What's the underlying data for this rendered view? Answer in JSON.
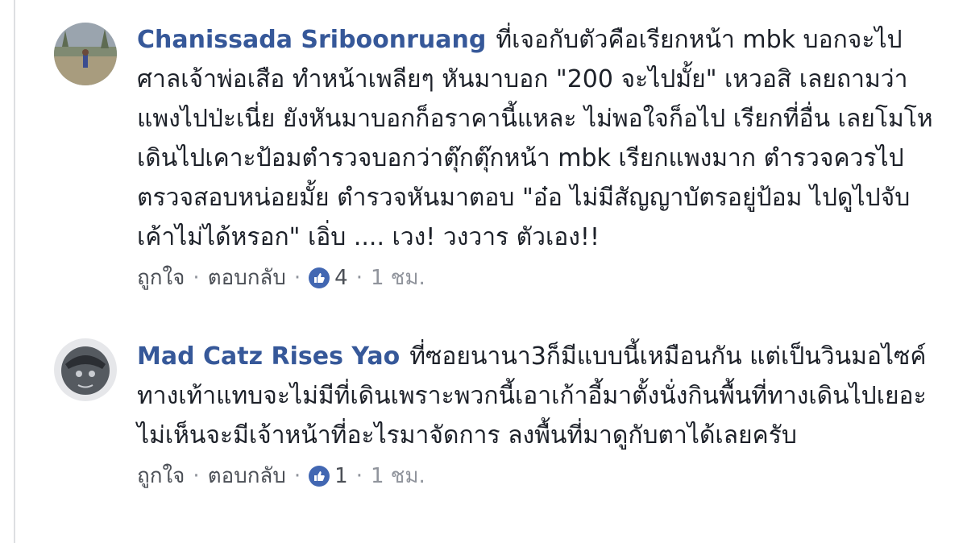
{
  "comments": [
    {
      "author": "Chanissada Sriboonruang",
      "text": "ที่เจอกับตัวคือเรียกหน้า mbk บอกจะไปศาลเจ้าพ่อเสือ ทำหน้าเพลียๆ หันมาบอก \"200 จะไปมั้ย\" เหวอสิ เลยถามว่าแพงไปป่ะเนี่ย ยังหันมาบอกก็อราคานี้แหละ ไม่พอใจก็อไป เรียกที่อื่น เลยโมโหเดินไปเคาะป้อมตำรวจบอกว่าตุ๊กตุ๊กหน้า mbk เรียกแพงมาก ตำรวจควรไปตรวจสอบหน่อยมั้ย ตำรวจหันมาตอบ \"อ๋อ ไม่มีสัญญาบัตรอยู่ป้อม ไปดูไปจับเค้าไม่ได้หรอก\" เอิ่บ .... เวง! วงวาร ตัวเอง!!",
      "like_label": "ถูกใจ",
      "reply_label": "ตอบกลับ",
      "reaction_count": "4",
      "time": "1 ชม."
    },
    {
      "author": "Mad Catz Rises Yao",
      "text": "ที่ซอยนานา3ก็มีแบบนี้เหมือนกัน แต่เป็นวินมอไซค์ ทางเท้าแทบจะไม่มีที่เดินเพราะพวกนี้เอาเก้าอี้มาตั้งนั่งกินพื้นที่ทางเดินไปเยอะ ไม่เห็นจะมีเจ้าหน้าที่อะไรมาจัดการ ลงพื้นที่มาดูกับตาได้เลยครับ",
      "like_label": "ถูกใจ",
      "reply_label": "ตอบกลับ",
      "reaction_count": "1",
      "time": "1 ชม."
    }
  ],
  "colors": {
    "author": "#365899",
    "meta": "#90949c",
    "like_badge": "#4267b2"
  },
  "icons": {
    "reaction": "like-thumb-icon"
  }
}
